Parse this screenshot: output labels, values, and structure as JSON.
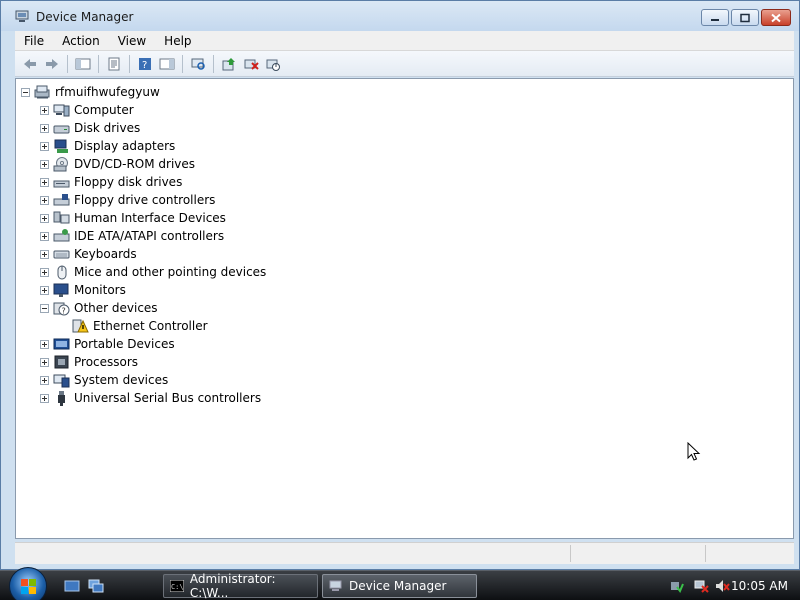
{
  "window": {
    "title": "Device Manager"
  },
  "menu": {
    "items": [
      "File",
      "Action",
      "View",
      "Help"
    ]
  },
  "toolbar": {
    "buttons": [
      "back-icon",
      "forward-icon",
      "show-hide-console-tree-icon",
      "properties-icon",
      "help-icon",
      "action-pane-icon",
      "scan-hardware-changes-icon",
      "update-driver-icon",
      "uninstall-icon",
      "disable-icon"
    ]
  },
  "tree": {
    "root": "rfmuifhwufegyuw",
    "categories": [
      {
        "label": "Computer",
        "icon": "computer-icon"
      },
      {
        "label": "Disk drives",
        "icon": "disk-drive-icon"
      },
      {
        "label": "Display adapters",
        "icon": "display-adapter-icon"
      },
      {
        "label": "DVD/CD-ROM drives",
        "icon": "dvd-drive-icon"
      },
      {
        "label": "Floppy disk drives",
        "icon": "floppy-drive-icon"
      },
      {
        "label": "Floppy drive controllers",
        "icon": "floppy-controller-icon"
      },
      {
        "label": "Human Interface Devices",
        "icon": "hid-icon"
      },
      {
        "label": "IDE ATA/ATAPI controllers",
        "icon": "ide-controller-icon"
      },
      {
        "label": "Keyboards",
        "icon": "keyboard-icon"
      },
      {
        "label": "Mice and other pointing devices",
        "icon": "mouse-icon"
      },
      {
        "label": "Monitors",
        "icon": "monitor-icon"
      },
      {
        "label": "Other devices",
        "icon": "other-devices-icon",
        "expanded": true
      },
      {
        "label": "Ethernet Controller",
        "icon": "warning-device-icon",
        "child": true
      },
      {
        "label": "Portable Devices",
        "icon": "portable-device-icon"
      },
      {
        "label": "Processors",
        "icon": "processor-icon"
      },
      {
        "label": "System devices",
        "icon": "system-devices-icon"
      },
      {
        "label": "Universal Serial Bus controllers",
        "icon": "usb-icon"
      }
    ]
  },
  "taskbar": {
    "tasks": [
      {
        "label": "Administrator: C:\\W...",
        "icon": "cmd-icon"
      },
      {
        "label": "Device Manager",
        "icon": "device-manager-icon",
        "active": true
      }
    ],
    "clock": "10:05 AM"
  }
}
